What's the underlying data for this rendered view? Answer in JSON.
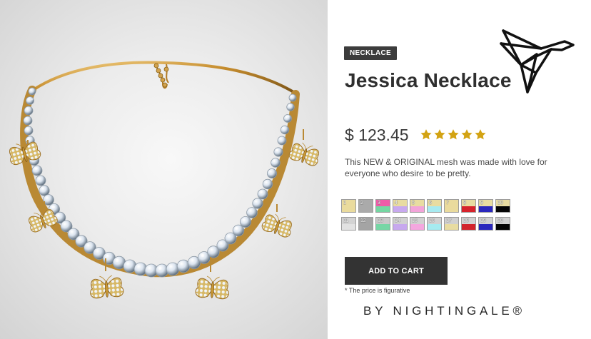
{
  "product": {
    "image_description": "",
    "category": "NECKLACE",
    "name": "Jessica Necklace",
    "price": "$ 123.45",
    "rating": 5,
    "rating_max": 5,
    "description": "This NEW & ORIGINAL mesh was made with love for everyone who desire to be pretty.",
    "cta_label": "ADD TO CART",
    "price_note": "* The price is figurative",
    "brand": "BY NIGHTINGALE®",
    "brand_icon": "origami-bird-icon"
  },
  "colors": {
    "badge": "#3c3c3c",
    "cta": "#333333",
    "star": "#d3a313",
    "text": "#2f2f2f"
  },
  "swatches": [
    {
      "number": "1",
      "top": "#eadb9d",
      "bottom": "#eadb9d"
    },
    {
      "number": "2",
      "top": "#aaaaaa",
      "bottom": "#aaaaaa"
    },
    {
      "number": "3",
      "top": "#ef5aa8",
      "bottom": "#75d6a2"
    },
    {
      "number": "4",
      "top": "#e8dca1",
      "bottom": "#c8a9ef"
    },
    {
      "number": "5",
      "top": "#e8dca1",
      "bottom": "#f2a4d9"
    },
    {
      "number": "6",
      "top": "#e8dca1",
      "bottom": "#a7eaf0"
    },
    {
      "number": "7",
      "top": "#eadb9d",
      "bottom": "#eadb9d"
    },
    {
      "number": "8",
      "top": "#e8dca1",
      "bottom": "#d6232c"
    },
    {
      "number": "9",
      "top": "#e8dca1",
      "bottom": "#2a27bd"
    },
    {
      "number": "10",
      "top": "#e8dca1",
      "bottom": "#050505"
    },
    {
      "number": "11",
      "top": "#d3d3d3",
      "bottom": "#e2e2e2"
    },
    {
      "number": "12",
      "top": "#a4a4a4",
      "bottom": "#a4a4a4"
    },
    {
      "number": "13",
      "top": "#c8c8c8",
      "bottom": "#76d6a5"
    },
    {
      "number": "14",
      "top": "#d1d1d1",
      "bottom": "#c7a8ee"
    },
    {
      "number": "15",
      "top": "#d1d1d1",
      "bottom": "#f4a7df"
    },
    {
      "number": "16",
      "top": "#d1d1d1",
      "bottom": "#a6ebf0"
    },
    {
      "number": "17",
      "top": "#d0d0d0",
      "bottom": "#e8dca1"
    },
    {
      "number": "18",
      "top": "#d2d2d2",
      "bottom": "#d2232c"
    },
    {
      "number": "19",
      "top": "#d2d2d2",
      "bottom": "#2a27bd"
    },
    {
      "number": "20",
      "top": "#d2d2d2",
      "bottom": "#050505"
    }
  ]
}
